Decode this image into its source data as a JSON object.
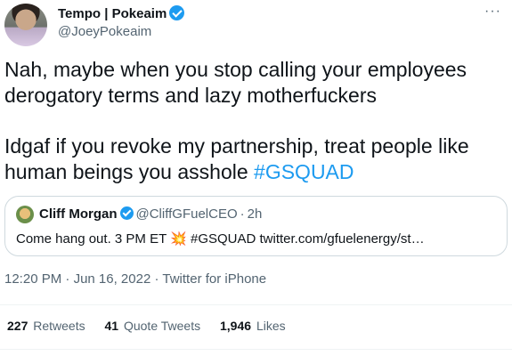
{
  "author": {
    "display_name": "Tempo | Pokeaim",
    "handle": "@JoeyPokeaim",
    "verified_icon": "verified-badge-icon"
  },
  "more_icon_glyph": "···",
  "tweet": {
    "line1": "Nah, maybe when you stop calling your employees",
    "line2": "derogatory terms and lazy motherfuckers",
    "line3": "Idgaf if you revoke my partnership, treat people like",
    "line4_text": "human beings you asshole ",
    "hashtag": "#GSQUAD"
  },
  "quoted": {
    "name": "Cliff Morgan",
    "handle": "@CliffGFuelCEO",
    "separator": "·",
    "time": "2h",
    "text": "Come hang out. 3 PM ET 💥 #GSQUAD twitter.com/gfuelenergy/st…"
  },
  "timestamp": {
    "time": "12:20 PM",
    "separator": "·",
    "date": "Jun 16, 2022",
    "source": "Twitter for iPhone"
  },
  "stats": [
    {
      "count": "227",
      "label": "Retweets"
    },
    {
      "count": "41",
      "label": "Quote Tweets"
    },
    {
      "count": "1,946",
      "label": "Likes"
    }
  ],
  "colors": {
    "accent": "#1d9bf0",
    "text": "#0f1419",
    "secondary": "#536471",
    "border": "#cfd9de"
  }
}
